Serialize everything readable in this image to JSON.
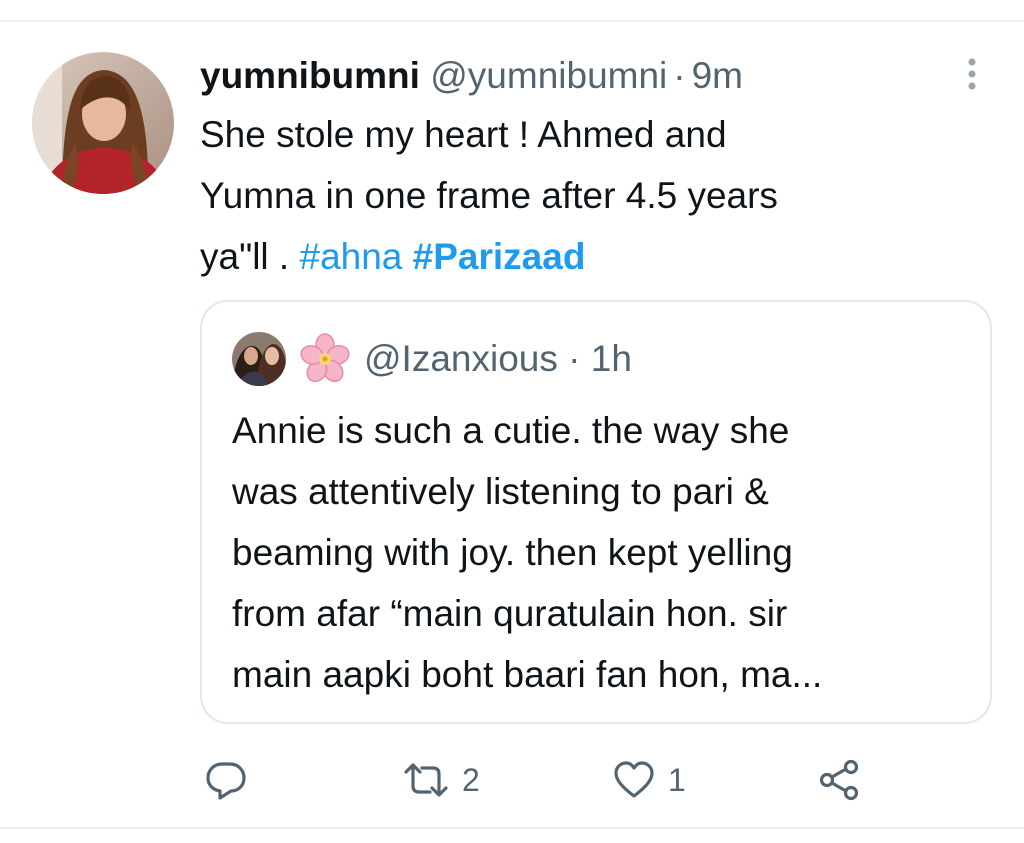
{
  "tweet": {
    "display_name": "yumnibumni",
    "handle": "@yumnibumni",
    "separator": "·",
    "time": "9m",
    "text_lines": [
      "She stole my heart ! Ahmed and",
      "Yumna in one frame after 4.5 years"
    ],
    "text_last_prefix": "ya\"ll . ",
    "hashtag_1": "#ahna",
    "hashtag_2": "#Parizaad"
  },
  "quoted_tweet": {
    "handle": "@Izanxious",
    "separator": "·",
    "time": "1h",
    "name_icon": "cherry-blossom-icon",
    "text_lines": [
      "Annie is such a cutie. the way she",
      "was attentively listening to pari &",
      "beaming with joy. then kept yelling",
      "from afar “main quratulain hon. sir",
      "main aapki boht baari fan hon, ma..."
    ]
  },
  "actions": {
    "reply_count": "",
    "retweet_count": "2",
    "like_count": "1"
  },
  "colors": {
    "link": "#1d9bf0",
    "text": "#0f1419",
    "secondary": "#536471",
    "border": "#e1e8ed"
  }
}
